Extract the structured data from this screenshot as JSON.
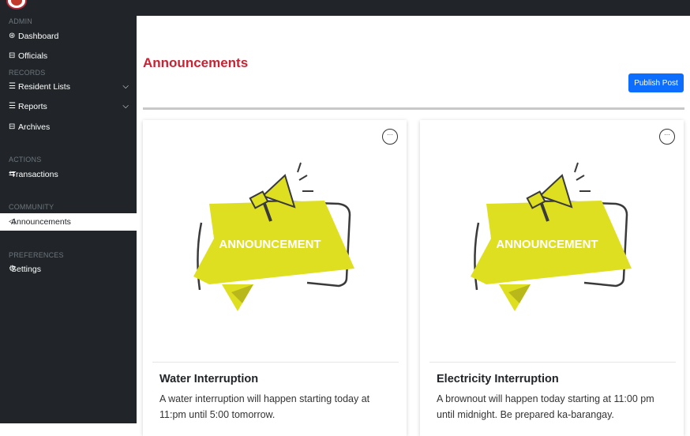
{
  "sidebar": {
    "sections": {
      "admin": "ADMIN",
      "records": "RECORDS",
      "actions": "ACTIONS",
      "community": "COMMUNITY",
      "preferences": "PREFERENCES"
    },
    "items": {
      "dashboard": "Dashboard",
      "officials": "Officials",
      "resident_lists": "Resident Lists",
      "reports": "Reports",
      "archives": "Archives",
      "transactions": "Transactions",
      "announcements": "Announcements",
      "settings": "Settings"
    }
  },
  "main": {
    "title": "Announcements",
    "publish_label": "Publish Post"
  },
  "cards": [
    {
      "image_text": "ANNOUNCEMENT",
      "title": "Water Interruption",
      "body": "A water interruption will happen starting today at 11:pm until 5:00 tomorrow."
    },
    {
      "image_text": "ANNOUNCEMENT",
      "title": "Electricity Interruption",
      "body": "A brownout will happen today starting at 11:00 pm until midnight. Be prepared ka-barangay."
    }
  ],
  "colors": {
    "sidebar_bg": "#212529",
    "title_red": "#c82333",
    "primary_blue": "#0d6efd",
    "banner_yellow": "#dfdf22"
  }
}
